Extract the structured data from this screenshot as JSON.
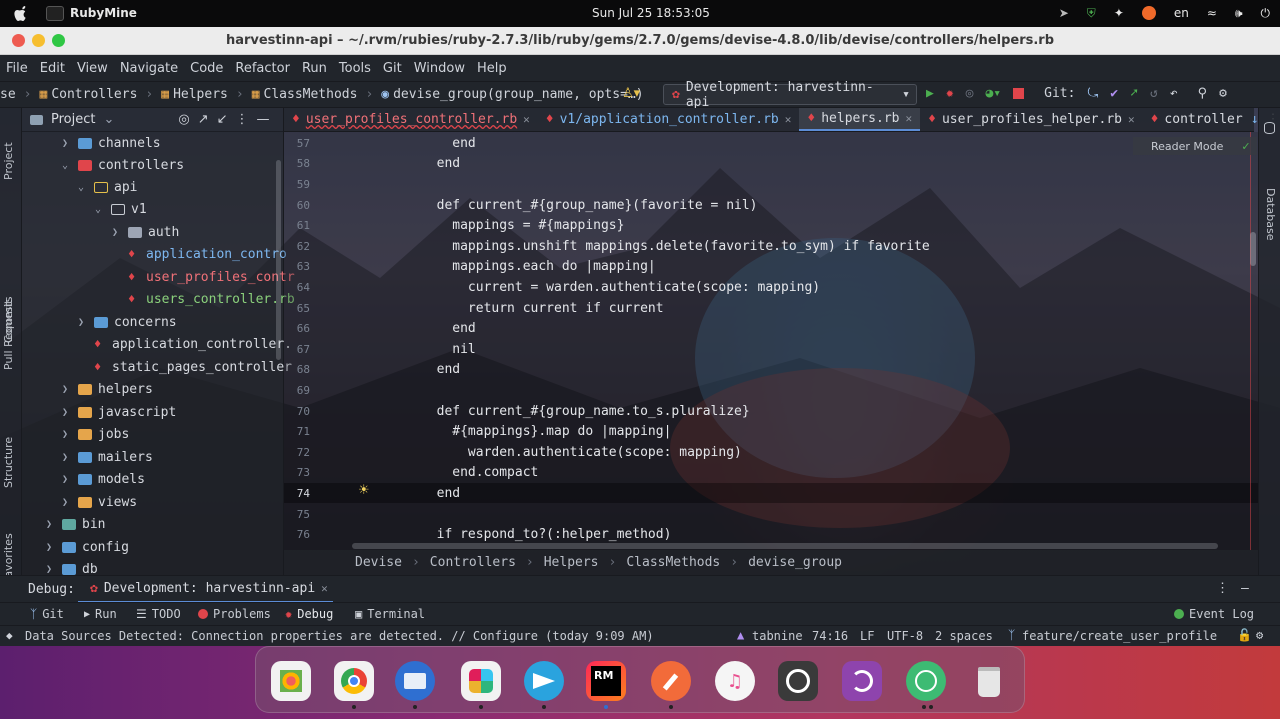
{
  "topbar": {
    "app_name": "RubyMine",
    "clock": "Sun Jul 25  18:53:05",
    "lang": "en"
  },
  "window": {
    "title": "harvestinn-api – ~/.rvm/rubies/ruby-2.7.3/lib/ruby/gems/2.7.0/gems/devise-4.8.0/lib/devise/controllers/helpers.rb"
  },
  "menu": [
    "File",
    "Edit",
    "View",
    "Navigate",
    "Code",
    "Refactor",
    "Run",
    "Tools",
    "Git",
    "Window",
    "Help"
  ],
  "nav": {
    "crumbs": [
      "se",
      "Controllers",
      "Helpers",
      "ClassMethods",
      "devise_group(group_name, opts=…)"
    ],
    "run_config": "Development: harvestinn-api",
    "git_label": "Git:"
  },
  "sidebar": {
    "project": "Project",
    "commit": "Commit",
    "pull_requests": "Pull Requests",
    "structure": "Structure",
    "favorites": "Favorites",
    "database": "Database"
  },
  "project_panel": {
    "title": "Project"
  },
  "tree": [
    {
      "label": "channels"
    },
    {
      "label": "controllers"
    },
    {
      "label": "api"
    },
    {
      "label": "v1"
    },
    {
      "label": "auth"
    },
    {
      "label": "application_contro"
    },
    {
      "label": "user_profiles_contr"
    },
    {
      "label": "users_controller.rb"
    },
    {
      "label": "concerns"
    },
    {
      "label": "application_controller."
    },
    {
      "label": "static_pages_controller"
    },
    {
      "label": "helpers"
    },
    {
      "label": "javascript"
    },
    {
      "label": "jobs"
    },
    {
      "label": "mailers"
    },
    {
      "label": "models"
    },
    {
      "label": "views"
    },
    {
      "label": "bin"
    },
    {
      "label": "config"
    },
    {
      "label": "db"
    }
  ],
  "tabs": [
    "user_profiles_controller.rb",
    "v1/application_controller.rb",
    "helpers.rb",
    "user_profiles_helper.rb",
    "controller"
  ],
  "reader_mode": "Reader Mode",
  "code": [
    {
      "n": "57",
      "text": "          end"
    },
    {
      "n": "58",
      "text": "        end"
    },
    {
      "n": "59",
      "text": ""
    },
    {
      "n": "60",
      "text": "        def current_#{group_name}(favorite = nil)"
    },
    {
      "n": "61",
      "text": "          mappings = #{mappings}"
    },
    {
      "n": "62",
      "text": "          mappings.unshift mappings.delete(favorite.to_sym) if favorite"
    },
    {
      "n": "63",
      "text": "          mappings.each do |mapping|"
    },
    {
      "n": "64",
      "text": "            current = warden.authenticate(scope: mapping)"
    },
    {
      "n": "65",
      "text": "            return current if current"
    },
    {
      "n": "66",
      "text": "          end"
    },
    {
      "n": "67",
      "text": "          nil"
    },
    {
      "n": "68",
      "text": "        end"
    },
    {
      "n": "69",
      "text": ""
    },
    {
      "n": "70",
      "text": "        def current_#{group_name.to_s.pluralize}"
    },
    {
      "n": "71",
      "text": "          #{mappings}.map do |mapping|"
    },
    {
      "n": "72",
      "text": "            warden.authenticate(scope: mapping)"
    },
    {
      "n": "73",
      "text": "          end.compact"
    },
    {
      "n": "74",
      "text": "        end"
    },
    {
      "n": "75",
      "text": ""
    },
    {
      "n": "76",
      "text": "        if respond_to?(:helper_method)"
    }
  ],
  "editor_crumbs": [
    "Devise",
    "Controllers",
    "Helpers",
    "ClassMethods",
    "devise_group"
  ],
  "debug": {
    "label": "Debug:",
    "config": "Development: harvestinn-api"
  },
  "toolwindows": [
    "Git",
    "Run",
    "TODO",
    "Problems",
    "Debug",
    "Terminal",
    "Event Log"
  ],
  "status": {
    "message": "Data Sources Detected: Connection properties are detected. // Configure (today 9:09 AM)",
    "tabnine": "tabnine",
    "position": "74:16",
    "line_sep": "LF",
    "encoding": "UTF-8",
    "indent": "2 spaces",
    "branch": "feature/create_user_profile"
  },
  "dock_apps": [
    "launchpad-icon",
    "chrome-icon",
    "thunderbird-icon",
    "slack-icon",
    "telegram-icon",
    "rubymine-icon",
    "postman-icon",
    "itunes-icon",
    "timer-icon",
    "podcast-icon",
    "atom-icon",
    "trash-icon"
  ]
}
